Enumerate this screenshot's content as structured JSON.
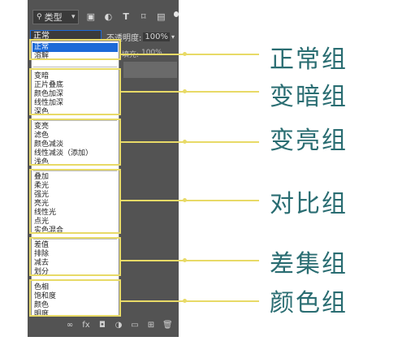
{
  "panel": {
    "filter_label": "类型",
    "blend_mode": "正常",
    "opacity_label": "不透明度:",
    "opacity_value": "100%",
    "fill_label": "填充:",
    "fill_value": "100%"
  },
  "blend_modes": {
    "normal": [
      "正常",
      "溶解"
    ],
    "darken": [
      "变暗",
      "正片叠底",
      "颜色加深",
      "线性加深",
      "深色"
    ],
    "lighten": [
      "变亮",
      "滤色",
      "颜色减淡",
      "线性减淡（添加）",
      "浅色"
    ],
    "contrast": [
      "叠加",
      "柔光",
      "强光",
      "亮光",
      "线性光",
      "点光",
      "实色混合"
    ],
    "difference": [
      "差值",
      "排除",
      "减去",
      "划分"
    ],
    "color": [
      "色相",
      "饱和度",
      "颜色",
      "明度"
    ]
  },
  "group_labels": [
    "正常组",
    "变暗组",
    "变亮组",
    "对比组",
    "差集组",
    "颜色组"
  ],
  "colors": {
    "accent_yellow": "#e8da67",
    "label_teal": "#2a6d72",
    "panel_gray": "#535353",
    "selected_blue": "#1c6ad8"
  }
}
